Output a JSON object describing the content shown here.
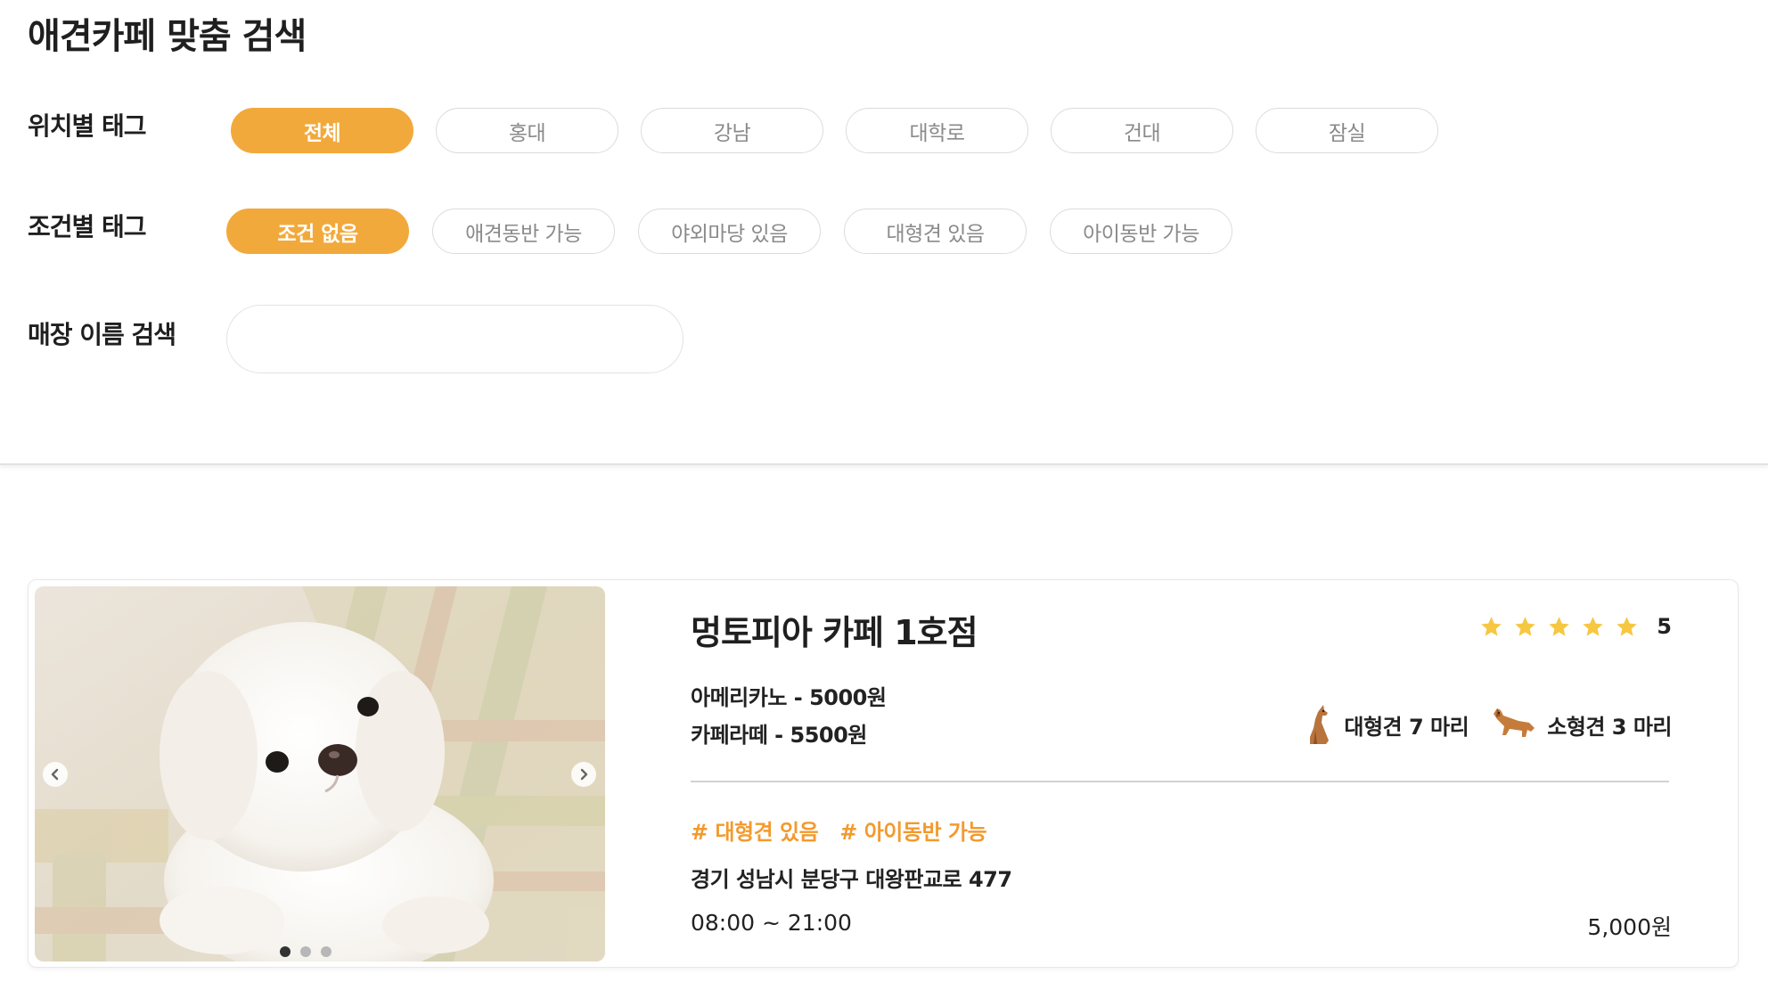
{
  "header": {
    "title": "애견카페 맞춤 검색"
  },
  "filters": {
    "location_label": "위치별 태그",
    "location_tags": [
      {
        "label": "전체",
        "active": true
      },
      {
        "label": "홍대",
        "active": false
      },
      {
        "label": "강남",
        "active": false
      },
      {
        "label": "대학로",
        "active": false
      },
      {
        "label": "건대",
        "active": false
      },
      {
        "label": "잠실",
        "active": false
      }
    ],
    "condition_label": "조건별 태그",
    "condition_tags": [
      {
        "label": "조건 없음",
        "active": true
      },
      {
        "label": "애견동반 가능",
        "active": false
      },
      {
        "label": "야외마당 있음",
        "active": false
      },
      {
        "label": "대형견 있음",
        "active": false
      },
      {
        "label": "아이동반 가능",
        "active": false
      }
    ],
    "name_search_label": "매장 이름 검색",
    "name_search_value": "",
    "name_search_placeholder": ""
  },
  "results": [
    {
      "name": "멍토피아 카페 1호점",
      "rating": 5,
      "rating_label": "5",
      "menu": [
        "아메리카노 - 5000원",
        "카페라떼 - 5500원"
      ],
      "large_dogs": "대형견 7 마리",
      "small_dogs": "소형견 3 마리",
      "hashtags": [
        "# 대형견 있음",
        "# 아이동반 가능"
      ],
      "address": "경기 성남시 분당구 대왕판교로 477",
      "hours": "08:00 ~ 21:00",
      "price": "5,000원",
      "carousel": {
        "slide_count": 3,
        "active_slide": 0
      }
    }
  ],
  "colors": {
    "accent": "#f2a93b",
    "hashtag": "#f29a2e",
    "star": "#f6c741",
    "tag_border": "#dcdcdc",
    "tag_text": "#8a8a8a"
  },
  "icons": {
    "large_dog": "large-dog-icon",
    "small_dog": "small-dog-icon",
    "rating": "star-icon",
    "prev": "chevron-left-icon",
    "next": "chevron-right-icon"
  }
}
